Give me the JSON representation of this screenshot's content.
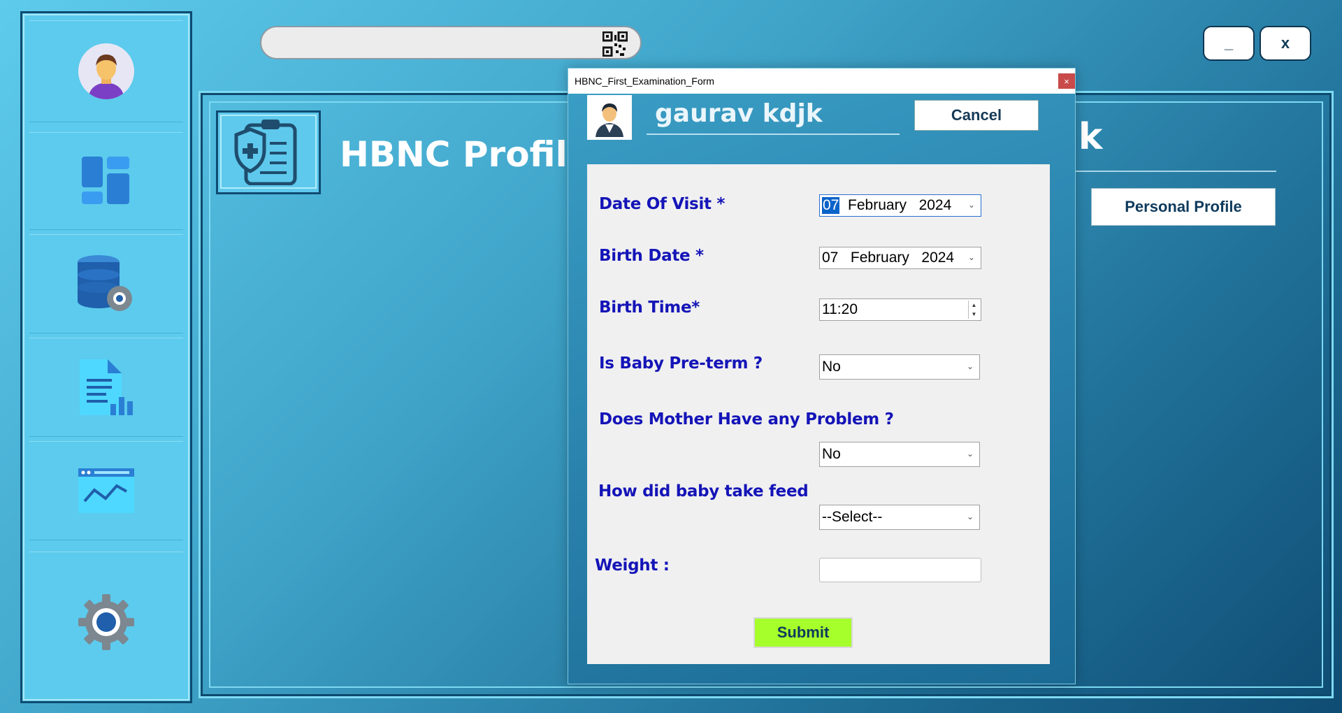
{
  "search": {
    "placeholder": "",
    "value": ""
  },
  "window_controls": {
    "minimize_label": "_",
    "close_label": "x"
  },
  "sidebar": {
    "items": [
      {
        "name": "user-avatar",
        "icon": "user-avatar-icon"
      },
      {
        "name": "dashboard",
        "icon": "dashboard-icon"
      },
      {
        "name": "database-settings",
        "icon": "database-gear-icon"
      },
      {
        "name": "reports",
        "icon": "report-document-icon"
      },
      {
        "name": "analytics",
        "icon": "analytics-window-icon"
      },
      {
        "name": "settings",
        "icon": "gear-icon"
      }
    ]
  },
  "main": {
    "title": "HBNC Profile",
    "name_partial": "jk",
    "personal_profile_label": "Personal Profile"
  },
  "dialog": {
    "title": "HBNC_First_Examination_Form",
    "close_label": "×",
    "patient_name": "gaurav kdjk",
    "cancel_label": "Cancel",
    "fields": {
      "date_of_visit": {
        "label": "Date Of Visit *",
        "day": "07",
        "rest": "  February   2024"
      },
      "birth_date": {
        "label": "Birth Date *",
        "value": "07   February   2024"
      },
      "birth_time": {
        "label": "Birth Time*",
        "value": "11:20"
      },
      "preterm": {
        "label": "Is Baby Pre-term ?",
        "value": "No"
      },
      "mother_problem": {
        "label": "Does Mother Have any Problem ?",
        "value": "No"
      },
      "feed": {
        "label": "How did baby take feed",
        "value": "--Select--"
      },
      "weight": {
        "label": "Weight :",
        "value": ""
      }
    },
    "submit_label": "Submit"
  },
  "colors": {
    "label_blue": "#1414b8",
    "submit_green": "#a6ff2a",
    "sidebar_bg": "#5ccbed",
    "close_red": "#c84a4a"
  }
}
